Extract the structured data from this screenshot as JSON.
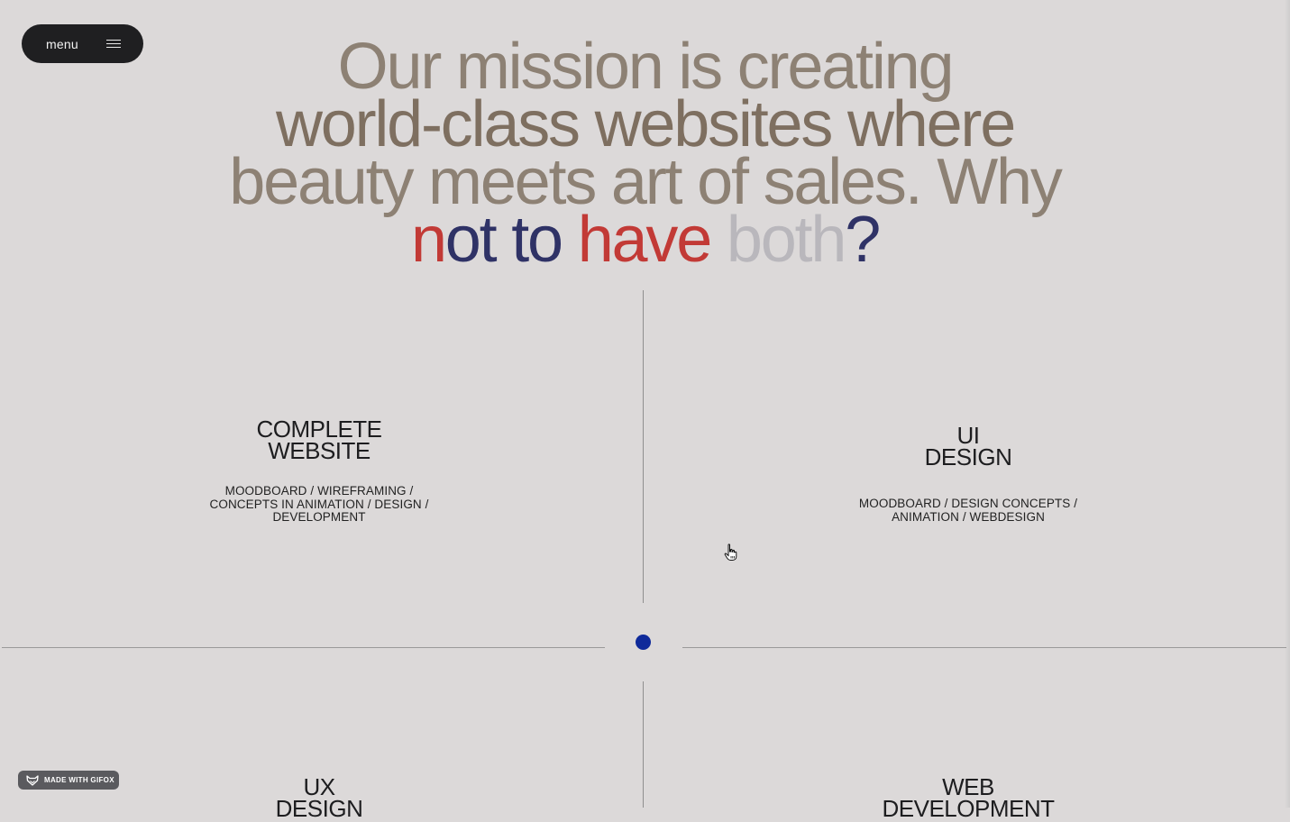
{
  "header": {
    "menu_label": "menu"
  },
  "mission": {
    "line1": "Our mission is creating",
    "line2": "world-class websites where",
    "line3": "beauty meets art of sales. Why",
    "line4_parts": [
      "n",
      "ot to",
      "have",
      "both",
      "?"
    ]
  },
  "services": [
    {
      "title_lines": [
        "COMPLETE",
        "WEBSITE"
      ],
      "tag_lines": [
        "MOODBOARD / WIREFRAMING /",
        "CONCEPTS IN ANIMATION / DESIGN /",
        "DEVELOPMENT"
      ]
    },
    {
      "title_lines": [
        "UI",
        "DESIGN"
      ],
      "tag_lines": [
        "MOODBOARD / DESIGN CONCEPTS /",
        "ANIMATION / WEBDESIGN"
      ]
    },
    {
      "title_lines": [
        "UX",
        "DESIGN"
      ]
    },
    {
      "title_lines": [
        "WEB",
        "DEVELOPMENT"
      ]
    }
  ],
  "badge": {
    "label": "MADE WITH GIFOX",
    "icon": "fox-icon"
  },
  "colors": {
    "background": "#dcd9d9",
    "accent_dot": "#0f2a9a",
    "headline_red": "#c23a36",
    "headline_navy": "#2f3266"
  }
}
